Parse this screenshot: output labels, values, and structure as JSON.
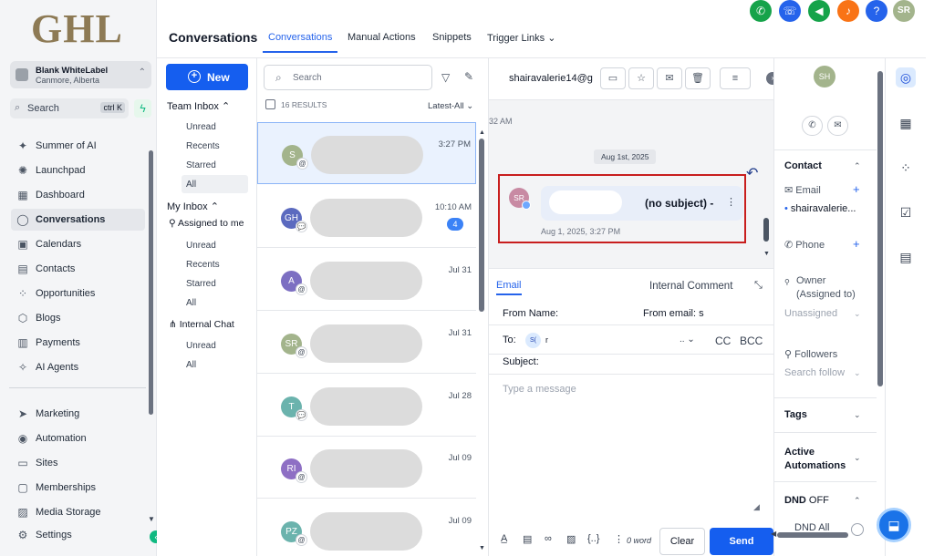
{
  "sidebar": {
    "logo": "GHL",
    "account": {
      "name": "Blank WhiteLabel",
      "location": "Canmore, Alberta"
    },
    "search": {
      "label": "Search",
      "shortcut": "ctrl K"
    },
    "items": [
      {
        "label": "Summer of AI",
        "icon": "sparkles-icon"
      },
      {
        "label": "Launchpad",
        "icon": "rocket-icon"
      },
      {
        "label": "Dashboard",
        "icon": "dashboard-icon"
      },
      {
        "label": "Conversations",
        "icon": "chat-icon",
        "active": true
      },
      {
        "label": "Calendars",
        "icon": "calendar-icon"
      },
      {
        "label": "Contacts",
        "icon": "contacts-icon"
      },
      {
        "label": "Opportunities",
        "icon": "opportunities-icon"
      },
      {
        "label": "Blogs",
        "icon": "cube-icon"
      },
      {
        "label": "Payments",
        "icon": "payments-icon"
      },
      {
        "label": "AI Agents",
        "icon": "ai-sparkle-icon"
      }
    ],
    "items2": [
      {
        "label": "Marketing",
        "icon": "send-icon"
      },
      {
        "label": "Automation",
        "icon": "automation-icon"
      },
      {
        "label": "Sites",
        "icon": "sites-icon"
      },
      {
        "label": "Memberships",
        "icon": "memberships-icon"
      },
      {
        "label": "Media Storage",
        "icon": "image-icon"
      },
      {
        "label": "Settings",
        "icon": "gear-icon"
      }
    ]
  },
  "header": {
    "title": "Conversations",
    "tabs": [
      "Conversations",
      "Manual Actions",
      "Snippets",
      "Trigger Links"
    ],
    "user_initials": "SR",
    "colors": {
      "phone": "#16a34a",
      "dialer": "#2563eb",
      "announce": "#16a34a",
      "bell": "#f97316",
      "help": "#2563eb"
    }
  },
  "inbox": {
    "new_label": "New",
    "team_inbox": "Team Inbox",
    "team_items": [
      "Unread",
      "Recents",
      "Starred",
      "All"
    ],
    "my_inbox": "My Inbox",
    "assigned": "Assigned to me",
    "my_items": [
      "Unread",
      "Recents",
      "Starred",
      "All"
    ],
    "internal_chat": "Internal Chat",
    "chat_items": [
      "Unread",
      "All"
    ]
  },
  "conversations": {
    "search_placeholder": "Search",
    "results": "16 RESULTS",
    "sort": "Latest-All",
    "items": [
      {
        "initials": "S",
        "time": "3:27 PM",
        "color": "#a3b48c",
        "channel": "@"
      },
      {
        "initials": "GH",
        "time": "10:10 AM",
        "color": "#5b6abf",
        "channel": "💬",
        "count": "4"
      },
      {
        "initials": "A",
        "time": "Jul 31",
        "color": "#7c6fc2",
        "channel": "@"
      },
      {
        "initials": "SR",
        "time": "Jul 31",
        "color": "#a3b48c",
        "channel": "@"
      },
      {
        "initials": "T",
        "time": "Jul 28",
        "color": "#6bb3ad",
        "channel": "💬"
      },
      {
        "initials": "RI",
        "time": "Jul 09",
        "color": "#8e6fc4",
        "channel": "@"
      },
      {
        "initials": "PZ",
        "time": "Jul 09",
        "color": "#6bb3ad",
        "channel": "@"
      }
    ]
  },
  "message": {
    "email": "shairavalerie14@g",
    "prev_time": "32 AM",
    "date_chip": "Aug 1st, 2025",
    "sender_initials": "SR",
    "subject": "(no subject)",
    "timestamp": "Aug 1, 2025, 3:27 PM",
    "annotation": "1"
  },
  "composer": {
    "tab_email": "Email",
    "tab_internal": "Internal Comment",
    "from_name": "From Name:",
    "from_email": "From email:",
    "from_email_value": "s",
    "to": "To:",
    "to_chip": "S(",
    "to_rest": "r",
    "to_select": "..",
    "cc": "CC",
    "bcc": "BCC",
    "subject": "Subject:",
    "placeholder": "Type a message",
    "word_count": "0 word",
    "clear": "Clear",
    "send": "Send"
  },
  "contact": {
    "initials": "SH",
    "contact_head": "Contact",
    "email_label": "Email",
    "email_value": "shairavalerie...",
    "phone_label": "Phone",
    "owner_label": "Owner",
    "owner_sub": "(Assigned to)",
    "owner_value": "Unassigned",
    "followers_label": "Followers",
    "followers_placeholder": "Search follow",
    "tags": "Tags",
    "active_automations": "Active Automations",
    "dnd_head": "DND",
    "dnd_state": "OFF",
    "dnd_all": "DND All"
  }
}
